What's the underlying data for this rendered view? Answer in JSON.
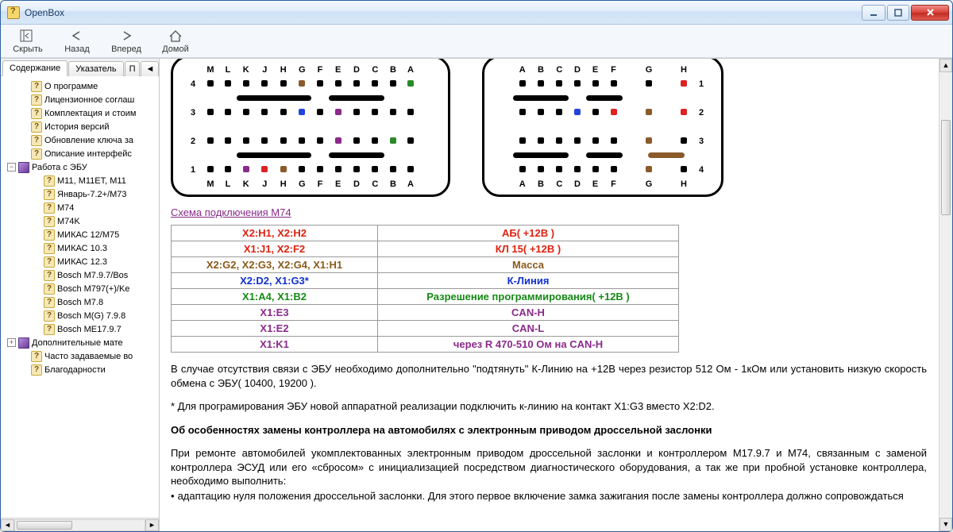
{
  "title": "OpenBox",
  "toolbar": {
    "hide": "Скрыть",
    "back": "Назад",
    "forward": "Вперед",
    "home": "Домой"
  },
  "tabs": {
    "contents": "Содержание",
    "index": "Указатель",
    "search": "П"
  },
  "tree": {
    "items": [
      {
        "level": 2,
        "label": "О программе"
      },
      {
        "level": 2,
        "label": "Лицензионное соглаш"
      },
      {
        "level": 2,
        "label": "Комплектация и стоим"
      },
      {
        "level": 2,
        "label": "История версий"
      },
      {
        "level": 2,
        "label": "Обновление ключа за"
      },
      {
        "level": 2,
        "label": "Описание интерфейс"
      }
    ],
    "ecu_group": "Работа с ЭБУ",
    "ecu_items": [
      "M11, M11ET, M11",
      "Январь-7.2+/M73",
      "M74",
      "M74K",
      "МИКАС 12/M75",
      "МИКАС 10.3",
      "МИКАС 12.3",
      "Bosch M7.9.7/Bos",
      "Bosch M797(+)/Ke",
      "Bosch M7.8",
      "Bosch M(G) 7.9.8",
      "Bosch ME17.9.7"
    ],
    "extra_group": "Дополнительные мате",
    "faq": "Часто задаваемые во",
    "thanks": "Благодарности"
  },
  "connector": {
    "top_labels_left": [
      "M",
      "L",
      "K",
      "J",
      "H",
      "G",
      "F",
      "E",
      "D",
      "C",
      "B",
      "A"
    ],
    "top_labels_right": [
      "A",
      "B",
      "C",
      "D",
      "E",
      "F",
      "G",
      "H"
    ],
    "row_nums": [
      "4",
      "3",
      "2",
      "1"
    ]
  },
  "schema_link": "Схема подключения M74",
  "pin_table": [
    {
      "pins": "X2:H1, X2:H2",
      "desc": "АБ( +12В )",
      "cls": "c-red"
    },
    {
      "pins": "X1:J1, X2:F2",
      "desc": "КЛ 15( +12В )",
      "cls": "c-red"
    },
    {
      "pins": "X2:G2, X2:G3, X2:G4, X1:H1",
      "desc": "Масса",
      "cls": "c-brown"
    },
    {
      "pins": "X2:D2, X1:G3*",
      "desc": "К-Линия",
      "cls": "c-blue"
    },
    {
      "pins": "X1:A4, X1:B2",
      "desc": "Разрешение программирования( +12В )",
      "cls": "c-green"
    },
    {
      "pins": "X1:E3",
      "desc": "CAN-H",
      "cls": "c-purple"
    },
    {
      "pins": "X1:E2",
      "desc": "CAN-L",
      "cls": "c-purple"
    },
    {
      "pins": "X1:K1",
      "desc": "через R 470-510 Ом на CAN-H",
      "cls": "c-purple"
    }
  ],
  "para1": "В случае отсутствия связи с ЭБУ необходимо дополнительно \"подтянуть\" К-Линию на +12В через резистор 512 Ом - 1кОм или установить низкую скорость обмена с ЭБУ( 10400, 19200 ).",
  "para2": "* Для програмирования ЭБУ новой аппаратной реализации подключить к-линию на контакт X1:G3 вместо X2:D2.",
  "heading2": "Об особенностях замены контроллера на автомобилях с электронным приводом дроссельной заслонки",
  "para3": "При ремонте автомобилей укомплектованных электронным приводом дроссельной заслонки и контроллером M17.9.7 и M74, связанным с заменой контроллера ЭСУД или его «сбросом» с инициализацией посредством диагностического оборудования, а так же при пробной установке контроллера, необходимо выполнить:",
  "bullet1": "адаптацию нуля положения дроссельной заслонки. Для этого первое включение замка зажигания после замены контроллера должно сопровождаться"
}
